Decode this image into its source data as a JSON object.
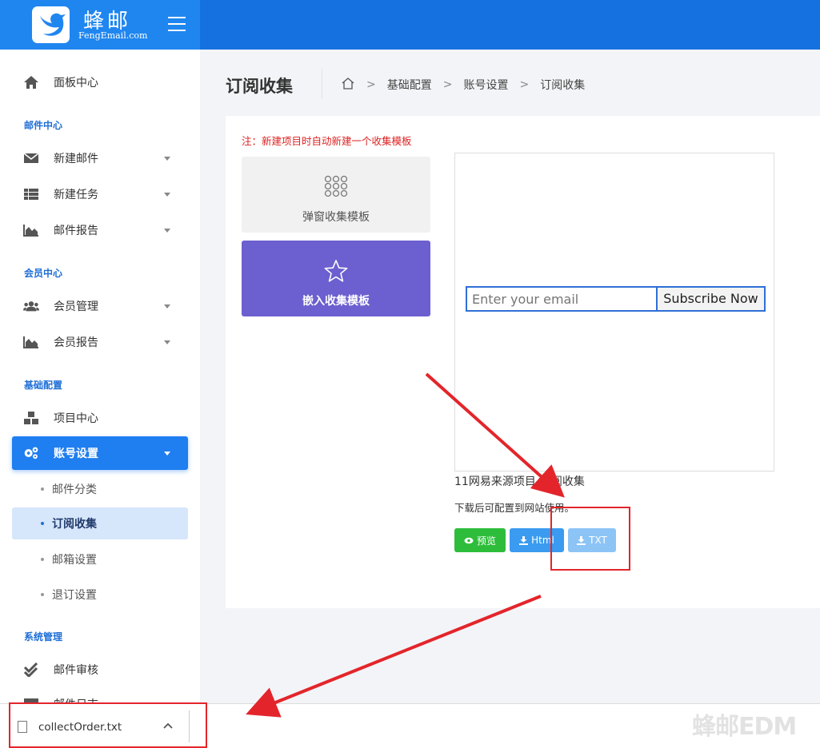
{
  "brand": {
    "name": "蜂邮",
    "sub": "FengEmail.com"
  },
  "sidebar": {
    "dashboard": "面板中心",
    "sections": {
      "mail": "邮件中心",
      "member": "会员中心",
      "basic": "基础配置",
      "system": "系统管理"
    },
    "mail_items": [
      "新建邮件",
      "新建任务",
      "邮件报告"
    ],
    "member_items": [
      "会员管理",
      "会员报告"
    ],
    "basic_items": [
      "项目中心",
      "账号设置"
    ],
    "sub_items": [
      "邮件分类",
      "订阅收集",
      "邮箱设置",
      "退订设置"
    ],
    "system_items": [
      "邮件审核",
      "邮件日志"
    ]
  },
  "page": {
    "title": "订阅收集",
    "breadcrumb": [
      "基础配置",
      "账号设置",
      "订阅收集"
    ]
  },
  "content": {
    "note": "注：新建项目时自动新建一个收集模板",
    "template_popup": "弹窗收集模板",
    "template_embed": "嵌入收集模板",
    "email_placeholder": "Enter your email",
    "subscribe_label": "Subscribe Now",
    "project_info": "11网易来源项目-订阅收集",
    "download_hint": "下载后可配置到网站使用。",
    "btn_preview": "预览",
    "btn_html": "Html",
    "btn_txt": "TXT"
  },
  "download_bar": {
    "filename": "collectOrder.txt"
  },
  "watermark": "蜂邮EDM",
  "colors": {
    "header": "#1571e0",
    "accent": "#1f7ef0",
    "embed": "#6c5fcf",
    "annotation": "#e3252b"
  }
}
